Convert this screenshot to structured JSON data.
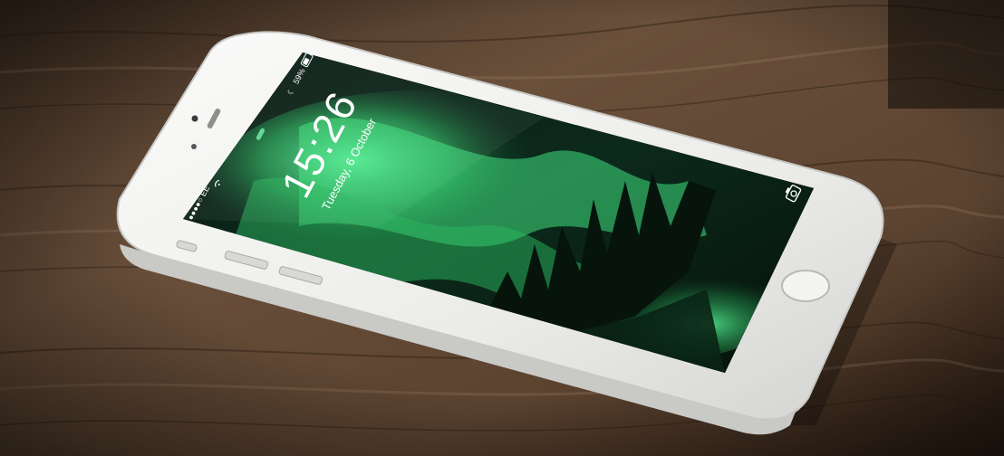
{
  "photo": {
    "subject": "white-smartphone-on-wooden-table",
    "icon_camera": "camera-icon",
    "icon_moon": "moon-icon",
    "icon_wifi": "wifi-icon",
    "icon_battery": "battery-icon"
  },
  "lockscreen": {
    "time": "15:26",
    "date": "Tuesday, 6 October",
    "carrier": "●●●●○ EE",
    "battery_percent": "59%",
    "wallpaper": "green-aurora-over-forest-lake"
  },
  "colors": {
    "wood_dark": "#2e2016",
    "wood_mid": "#5a4331",
    "wood_light": "#8a6b4f",
    "phone_body": "#f1f1ef",
    "aurora_green": "#38e07a",
    "sky_dark": "#07130f"
  }
}
